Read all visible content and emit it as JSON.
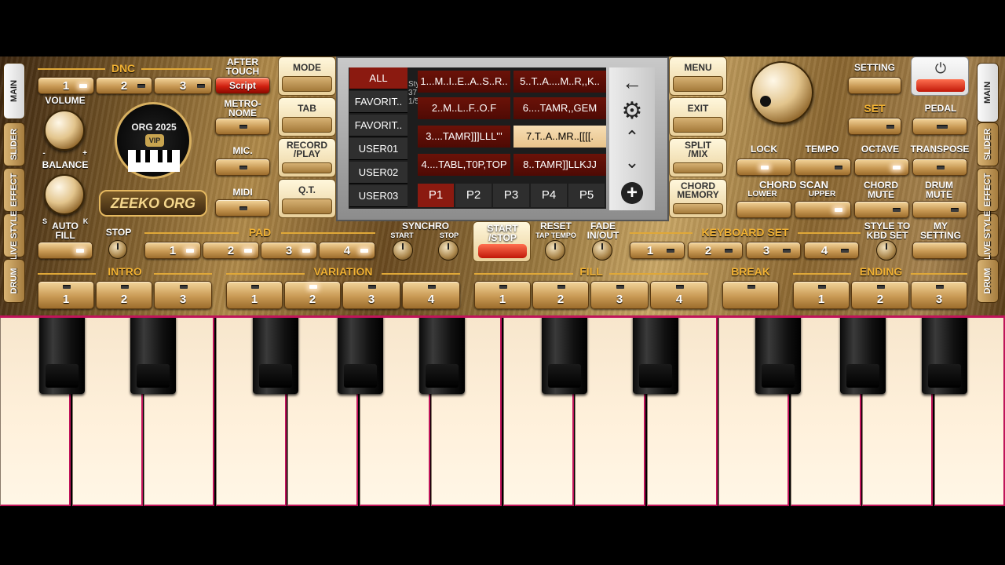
{
  "tabs_left": [
    "MAIN",
    "SLIDER",
    "EFFECT",
    "LIVE STYLE",
    "DRUM"
  ],
  "tabs_right": [
    "MAIN",
    "SLIDER",
    "EFFECT",
    "LIVE STYLE",
    "DRUM"
  ],
  "dnc": {
    "title": "DNC",
    "b1": "1",
    "b2": "2",
    "b3": "3"
  },
  "after_touch": {
    "label": "AFTER\nTOUCH",
    "value": "Script"
  },
  "volume": "VOLUME",
  "balance": "BALANCE",
  "plus": "+",
  "minus": "-",
  "s": "S",
  "k": "K",
  "metronome": "METRO-\nNOME",
  "mic": "MIC.",
  "midi": "MIDI",
  "logo": {
    "org": "ORG 2025",
    "vip": "VIP",
    "brand": "ZEEKO ORG"
  },
  "mode_buttons": [
    "MODE",
    "TAB",
    "RECORD\n/PLAY",
    "Q.T."
  ],
  "categories": [
    "ALL",
    "FAVORIT..",
    "FAVORIT..",
    "USER01",
    "USER02",
    "USER03"
  ],
  "side_text": "Style\n37\n1/5",
  "styles": [
    "1...M..I..E..A..S..R..",
    "5..T..A....M..R,,K..",
    "2..M..L..F..O.F",
    "6....TAMR,,GEM",
    "3....TAMR]]]LLL'''",
    "7.T..A..MR..[[[[.",
    "4....TABL,T0P,TOP",
    "8..TAMR]]LLKJJ"
  ],
  "pages": [
    "P1",
    "P2",
    "P3",
    "P4",
    "P5"
  ],
  "right_mode": [
    "MENU",
    "EXIT",
    "SPLIT\n/MIX",
    "CHORD\nMEMORY"
  ],
  "setting": "SETTING",
  "set": "SET",
  "pedal": "PEDAL",
  "lock": "LOCK",
  "tempo": "TEMPO",
  "octave": "OCTAVE",
  "transpose": "TRANSPOSE",
  "chord_scan": "CHORD SCAN",
  "lower": "LOWER",
  "upper": "UPPER",
  "chord_mute": "CHORD\nMUTE",
  "drum_mute": "DRUM\nMUTE",
  "auto_fill": "AUTO\nFILL",
  "stop": "STOP",
  "pad": {
    "title": "PAD",
    "b": [
      "1",
      "2",
      "3",
      "4"
    ]
  },
  "synchro": "SYNCHRO",
  "synchro_start": "START",
  "synchro_stop": "STOP",
  "start_stop": "START\n/STOP",
  "reset": "RESET",
  "tap_tempo": "TAP TEMPO",
  "fade": "FADE\nIN/OUT",
  "keyboard_set": {
    "title": "KEYBOARD SET",
    "b": [
      "1",
      "2",
      "3",
      "4"
    ]
  },
  "style_to_kbd": "STYLE TO\nKBD SET",
  "my_setting": "MY\nSETTING",
  "intro": {
    "title": "INTRO",
    "b": [
      "1",
      "2",
      "3"
    ]
  },
  "variation": {
    "title": "VARIATION",
    "b": [
      "1",
      "2",
      "3",
      "4"
    ]
  },
  "fill": {
    "title": "FILL",
    "b": [
      "1",
      "2",
      "3",
      "4"
    ]
  },
  "break": "BREAK",
  "ending": {
    "title": "ENDING",
    "b": [
      "1",
      "2",
      "3"
    ]
  },
  "colors": {
    "gold": "#f2b233",
    "red": "#d02010",
    "pink": "#c0145a"
  }
}
